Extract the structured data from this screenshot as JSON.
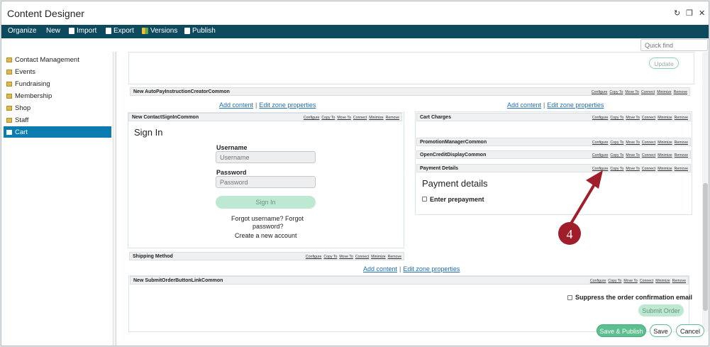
{
  "window": {
    "title": "Content Designer",
    "controls": [
      "↻",
      "❐",
      "✕"
    ]
  },
  "toolbar": {
    "organize": "Organize",
    "new": "New",
    "import": "Import",
    "export": "Export",
    "versions": "Versions",
    "publish": "Publish"
  },
  "search": {
    "placeholder": "Quick find"
  },
  "sidebar": {
    "items": [
      {
        "label": "Contact Management",
        "active": false
      },
      {
        "label": "Events",
        "active": false
      },
      {
        "label": "Fundraising",
        "active": false
      },
      {
        "label": "Membership",
        "active": false
      },
      {
        "label": "Shop",
        "active": false
      },
      {
        "label": "Staff",
        "active": false
      },
      {
        "label": "Cart",
        "active": true
      }
    ]
  },
  "wp_links": [
    "Configure",
    "Copy To",
    "Move To",
    "Connect",
    "Minimize",
    "Remove"
  ],
  "zone": {
    "add_content": "Add content",
    "separator": "|",
    "edit_zone": "Edit zone properties"
  },
  "top_zone": {
    "update_button": "Update"
  },
  "parts": {
    "autopay": "New AutoPayInstructionCreatorCommon",
    "signin": "New ContactSignInCommon",
    "cart_charges": "Cart Charges",
    "promotion": "PromotionManagerCommon",
    "open_credit": "OpenCreditDisplayCommon",
    "payment": "Payment Details",
    "shipping": "Shipping Method",
    "submit_order": "New SubmitOrderButtonLinkCommon"
  },
  "signin_form": {
    "heading": "Sign In",
    "username_label": "Username",
    "username_placeholder": "Username",
    "password_label": "Password",
    "password_placeholder": "Password",
    "signin_button": "Sign In",
    "forgot_line1": "Forgot username? Forgot",
    "forgot_line2": "password?",
    "create_account": "Create a new account"
  },
  "payment": {
    "heading": "Payment details",
    "prepayment_label": "Enter prepayment"
  },
  "submit": {
    "suppress_label": "Suppress the order confirmation email",
    "submit_button": "Submit Order"
  },
  "footer": {
    "save_publish": "Save & Publish",
    "save": "Save",
    "cancel": "Cancel"
  },
  "annotation": {
    "number": "4",
    "color": "#a01e2a"
  }
}
